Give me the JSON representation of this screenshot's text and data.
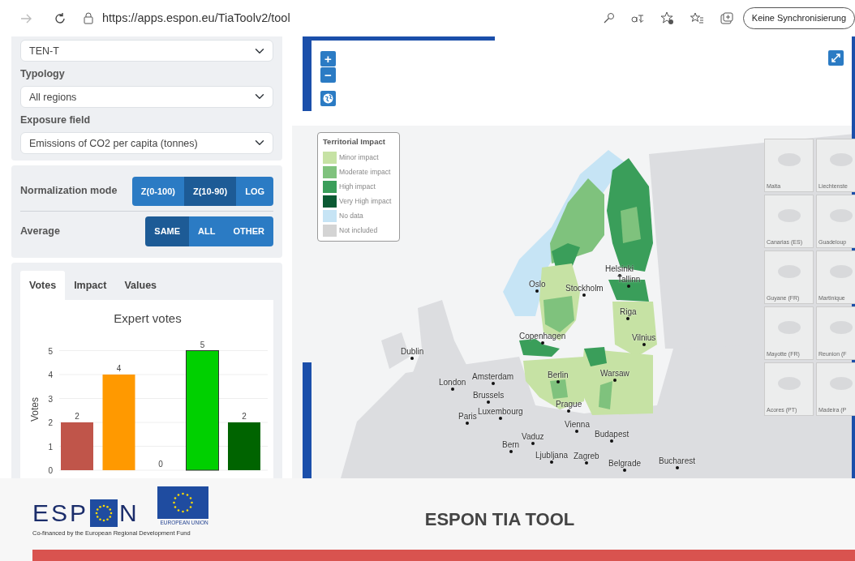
{
  "browser": {
    "url": "https://apps.espon.eu/TiaToolv2/tool",
    "sync_button": "Keine Synchronisierung"
  },
  "filters": [
    {
      "value": "TEN-T"
    },
    {
      "label": "Typology",
      "value": "All regions"
    },
    {
      "label": "Exposure field",
      "value": "Emissions of CO2 per capita (tonnes)"
    }
  ],
  "normalization": {
    "label": "Normalization mode",
    "options": [
      {
        "label": "Z(0-100)",
        "selected": false
      },
      {
        "label": "Z(10-90)",
        "selected": true
      },
      {
        "label": "LOG",
        "selected": false
      }
    ]
  },
  "average": {
    "label": "Average",
    "options": [
      {
        "label": "SAME",
        "selected": true
      },
      {
        "label": "ALL",
        "selected": false
      },
      {
        "label": "OTHER",
        "selected": false
      }
    ]
  },
  "tabs": [
    {
      "label": "Votes",
      "selected": true
    },
    {
      "label": "Impact",
      "selected": false
    },
    {
      "label": "Values",
      "selected": false
    }
  ],
  "chart_data": {
    "type": "bar",
    "title": "Expert votes",
    "ylabel": "Votes",
    "values": [
      2,
      4,
      0,
      5,
      2
    ],
    "colors": [
      "#c0554a",
      "#ff9900",
      null,
      "#00d000",
      "#006400"
    ],
    "yticks": [
      0,
      1,
      2,
      3,
      4,
      5
    ],
    "ylim": [
      0,
      5
    ],
    "grid": true,
    "data_labels": true
  },
  "map": {
    "zoom_in": "+",
    "zoom_out": "−",
    "legend": {
      "title": "Territorial Impact",
      "items": [
        {
          "label": "Minor impact",
          "color": "#c6e2a4"
        },
        {
          "label": "Moderate impact",
          "color": "#7fc27d"
        },
        {
          "label": "High impact",
          "color": "#3a9e5a"
        },
        {
          "label": "Very High impact",
          "color": "#0b5a33"
        },
        {
          "label": "No data",
          "color": "#c6e4f5"
        },
        {
          "label": "Not included",
          "color": "#d4d4d4"
        }
      ]
    },
    "cities": [
      "Oslo",
      "Stockholm",
      "Helsinki",
      "Tallinn",
      "Riga",
      "Copenhagen",
      "Vilnius",
      "Dublin",
      "Amsterdam",
      "London",
      "Berlin",
      "Warsaw",
      "Brussels",
      "Prague",
      "Luxembourg",
      "Paris",
      "Vienna",
      "Budapest",
      "Bern",
      "Vaduz",
      "Ljubljana",
      "Zagreb",
      "Belgrade",
      "Bucharest"
    ],
    "insets": [
      "Malta",
      "Liechtenste",
      "Canarias (ES)",
      "Guadeloup",
      "Guyane (FR)",
      "Martinique",
      "Mayotte (FR)",
      "Reunion (F",
      "Acores (PT)",
      "Madeira (P"
    ]
  },
  "footer": {
    "logo_start": "ESP",
    "logo_end": "N",
    "flag_caption": "EUROPEAN UNION",
    "cofinance": "Co-financed by the European Regional Development Fund",
    "title": "ESPON TIA TOOL"
  }
}
